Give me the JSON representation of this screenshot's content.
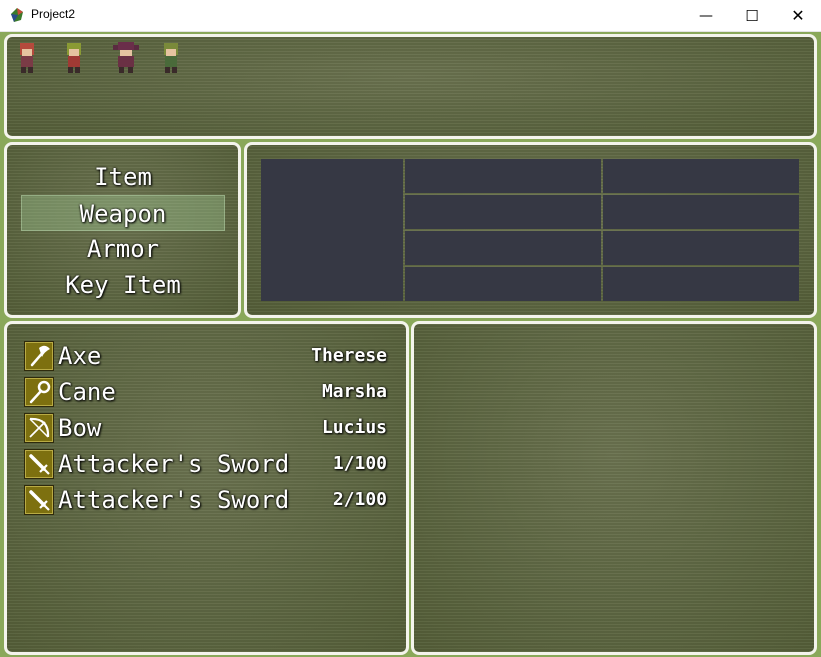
{
  "window": {
    "title": "Project2",
    "minimize_glyph": "—",
    "maximize_glyph": "☐",
    "close_glyph": "✕"
  },
  "colors": {
    "window_bg": "#5b6540",
    "window_border": "#f4f4ec",
    "status_cell": "#363844",
    "highlight": "#afdca5",
    "icon_bg": "#7d700f"
  },
  "party": [
    "actor-1",
    "actor-2",
    "actor-3",
    "actor-4"
  ],
  "categories": {
    "items": [
      "Item",
      "Weapon",
      "Armor",
      "Key Item"
    ],
    "selected": "Weapon"
  },
  "items": [
    {
      "icon": "axe-icon",
      "name": "Axe",
      "value": "Therese"
    },
    {
      "icon": "cane-icon",
      "name": "Cane",
      "value": "Marsha"
    },
    {
      "icon": "bow-icon",
      "name": "Bow",
      "value": "Lucius"
    },
    {
      "icon": "sword-icon",
      "name": "Attacker's Sword",
      "value": "1/100"
    },
    {
      "icon": "sword-icon",
      "name": "Attacker's Sword",
      "value": "2/100"
    }
  ]
}
